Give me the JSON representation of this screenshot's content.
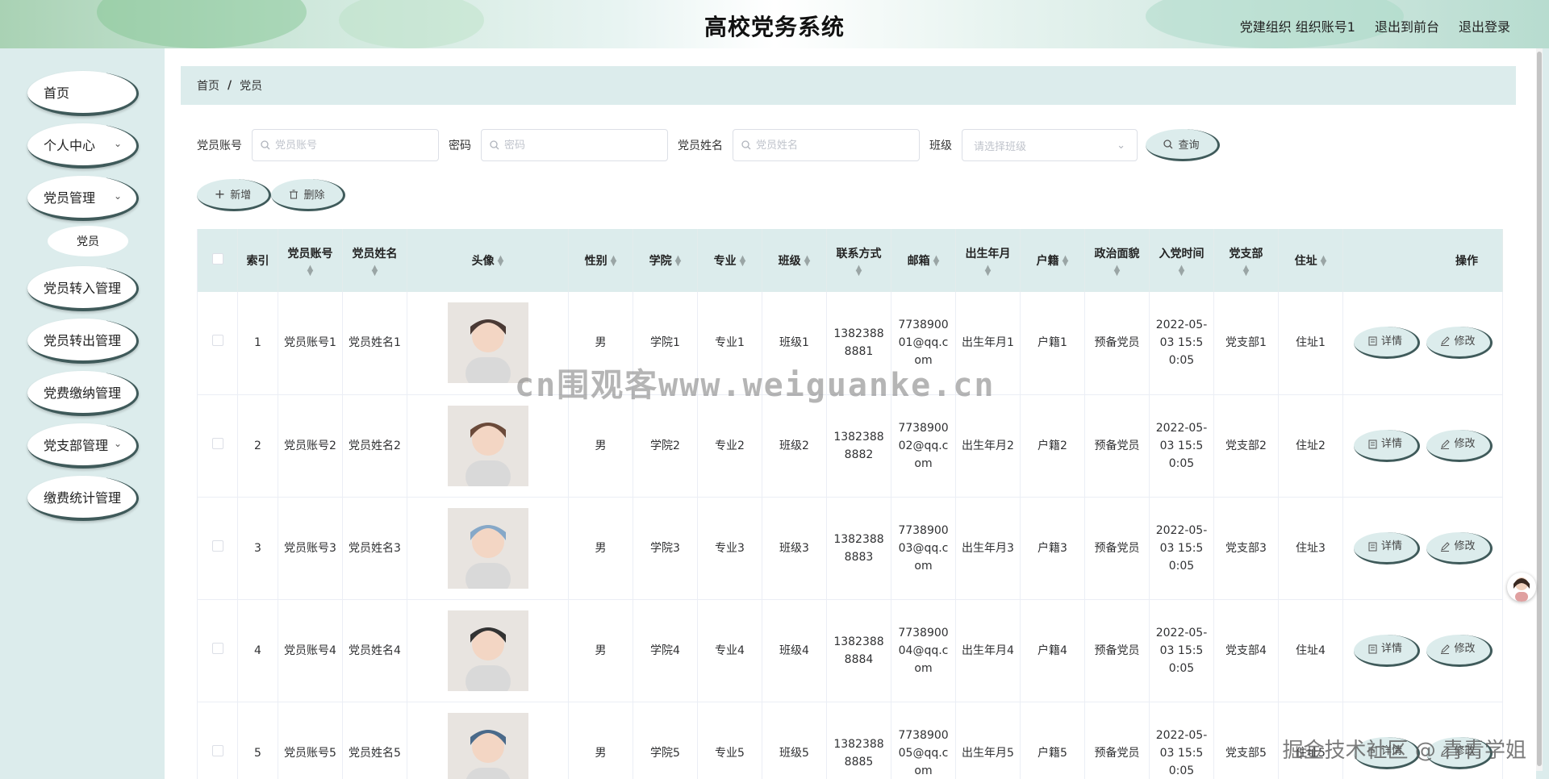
{
  "header": {
    "title": "高校党务系统",
    "user_label": "党建组织 组织账号1",
    "to_front_label": "退出到前台",
    "logout_label": "退出登录"
  },
  "sidebar": {
    "items": [
      {
        "label": "首页",
        "has_children": false
      },
      {
        "label": "个人中心",
        "has_children": true
      },
      {
        "label": "党员管理",
        "has_children": true
      },
      {
        "label": "党员转入管理",
        "has_children": false
      },
      {
        "label": "党员转出管理",
        "has_children": false
      },
      {
        "label": "党费缴纳管理",
        "has_children": false
      },
      {
        "label": "党支部管理",
        "has_children": true
      },
      {
        "label": "缴费统计管理",
        "has_children": false
      }
    ],
    "sub_item": "党员"
  },
  "breadcrumb": {
    "home": "首页",
    "separator": "/",
    "current": "党员"
  },
  "search": {
    "account_label": "党员账号",
    "account_placeholder": "党员账号",
    "password_label": "密码",
    "password_placeholder": "密码",
    "name_label": "党员姓名",
    "name_placeholder": "党员姓名",
    "class_label": "班级",
    "class_placeholder": "请选择班级",
    "query_label": "查询"
  },
  "toolbar": {
    "add_label": "新增",
    "delete_label": "删除"
  },
  "table": {
    "columns": [
      "索引",
      "党员账号",
      "党员姓名",
      "头像",
      "性别",
      "学院",
      "专业",
      "班级",
      "联系方式",
      "邮箱",
      "出生年月",
      "户籍",
      "政治面貌",
      "入党时间",
      "党支部",
      "住址",
      "操作"
    ],
    "detail_label": "详情",
    "edit_label": "修改",
    "rows": [
      {
        "index": "1",
        "account": "党员账号1",
        "name": "党员姓名1",
        "gender": "男",
        "college": "学院1",
        "major": "专业1",
        "class": "班级1",
        "phone": "13823888881",
        "email": "773890001@qq.com",
        "birth": "出生年月1",
        "hukou": "户籍1",
        "political": "预备党员",
        "join_time": "2022-05-03 15:50:05",
        "branch": "党支部1",
        "address": "住址1",
        "avatar_color": "#4a3a35"
      },
      {
        "index": "2",
        "account": "党员账号2",
        "name": "党员姓名2",
        "gender": "男",
        "college": "学院2",
        "major": "专业2",
        "class": "班级2",
        "phone": "13823888882",
        "email": "773890002@qq.com",
        "birth": "出生年月2",
        "hukou": "户籍2",
        "political": "预备党员",
        "join_time": "2022-05-03 15:50:05",
        "branch": "党支部2",
        "address": "住址2",
        "avatar_color": "#6b4a3a"
      },
      {
        "index": "3",
        "account": "党员账号3",
        "name": "党员姓名3",
        "gender": "男",
        "college": "学院3",
        "major": "专业3",
        "class": "班级3",
        "phone": "13823888883",
        "email": "773890003@qq.com",
        "birth": "出生年月3",
        "hukou": "户籍3",
        "political": "预备党员",
        "join_time": "2022-05-03 15:50:05",
        "branch": "党支部3",
        "address": "住址3",
        "avatar_color": "#86a8c8"
      },
      {
        "index": "4",
        "account": "党员账号4",
        "name": "党员姓名4",
        "gender": "男",
        "college": "学院4",
        "major": "专业4",
        "class": "班级4",
        "phone": "13823888884",
        "email": "773890004@qq.com",
        "birth": "出生年月4",
        "hukou": "户籍4",
        "political": "预备党员",
        "join_time": "2022-05-03 15:50:05",
        "branch": "党支部4",
        "address": "住址4",
        "avatar_color": "#333333"
      },
      {
        "index": "5",
        "account": "党员账号5",
        "name": "党员姓名5",
        "gender": "男",
        "college": "学院5",
        "major": "专业5",
        "class": "班级5",
        "phone": "13823888885",
        "email": "773890005@qq.com",
        "birth": "出生年月5",
        "hukou": "户籍5",
        "political": "预备党员",
        "join_time": "2022-05-03 15:50:05",
        "branch": "党支部5",
        "address": "住址5",
        "avatar_color": "#4a6a8a"
      }
    ]
  },
  "watermarks": {
    "center": "cn围观客www.weiguanke.cn",
    "bottom_right": "掘金技术社区 @ 青青学姐"
  },
  "colors": {
    "accent": "#dcecec",
    "button_border": "#3f5a5a"
  }
}
